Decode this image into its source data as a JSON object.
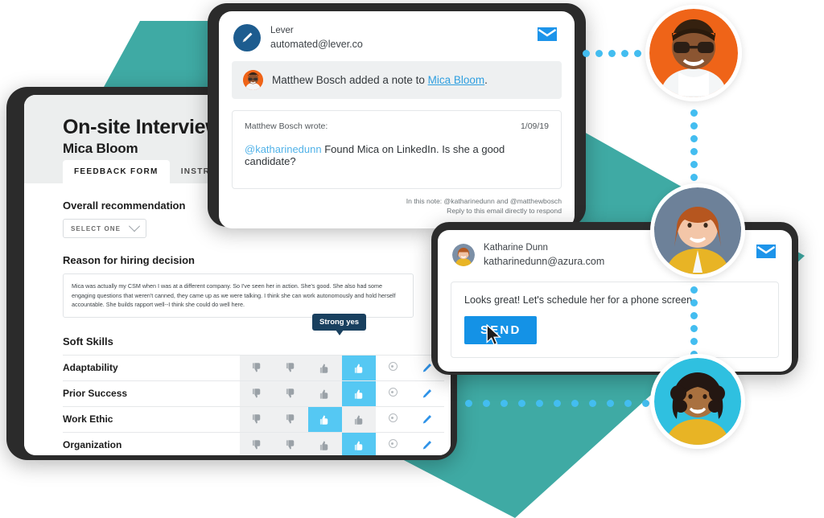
{
  "background": {
    "teal": "#3faaa4",
    "dot_color": "#43bdf0"
  },
  "interview_card": {
    "title": "On-site Interview",
    "candidate": "Mica Bloom",
    "tabs": [
      {
        "label": "FEEDBACK FORM",
        "active": true
      },
      {
        "label": "INSTRUCTIONS",
        "active": false
      }
    ],
    "recommendation_label": "Overall recommendation",
    "recommendation_value": "SELECT ONE",
    "reason_label": "Reason for hiring decision",
    "reason_text": "Mica was actually my CSM when I was at a different company. So I've seen her in action. She's good. She also had some engaging questions that weren't canned, they came up as we were talking. I think she can work autonomously and hold herself accountable. She builds rapport well--I think she could do well here.",
    "skills_section_title": "Soft Skills",
    "tooltip": "Strong yes",
    "rating_columns": [
      "strong-no",
      "no",
      "yes",
      "strong-yes",
      "no-opinion",
      "note"
    ],
    "skills": [
      {
        "name": "Adaptability",
        "selected": 3
      },
      {
        "name": "Prior Success",
        "selected": 3
      },
      {
        "name": "Work Ethic",
        "selected": 2
      },
      {
        "name": "Organization",
        "selected": 3
      }
    ]
  },
  "note_email": {
    "from_name": "Lever",
    "from_address": "automated@lever.co",
    "banner_before": "Matthew Bosch added a note to ",
    "banner_link": "Mica Bloom",
    "banner_after": ".",
    "wrote_label": "Matthew Bosch wrote:",
    "date": "1/09/19",
    "mention": "@katharinedunn",
    "body": " Found Mica on LinkedIn. Is she a good candidate?",
    "footer_line1": "In this note: @katharinedunn and @matthewbosch",
    "footer_line2": "Reply to this email directly to respond",
    "envelope_icon": "envelope-icon"
  },
  "reply_email": {
    "from_name": "Katharine Dunn",
    "from_address": "katharinedunn@azura.com",
    "message": "Looks great! Let's schedule her for a phone screen.",
    "send_label": "SEND",
    "envelope_icon": "envelope-icon"
  },
  "avatars": [
    {
      "name": "avatar-matthew-bosch",
      "bg": "#ef6418"
    },
    {
      "name": "avatar-katharine-dunn",
      "bg": "#6d8199"
    },
    {
      "name": "avatar-candidate",
      "bg": "#2fc0e0"
    }
  ]
}
